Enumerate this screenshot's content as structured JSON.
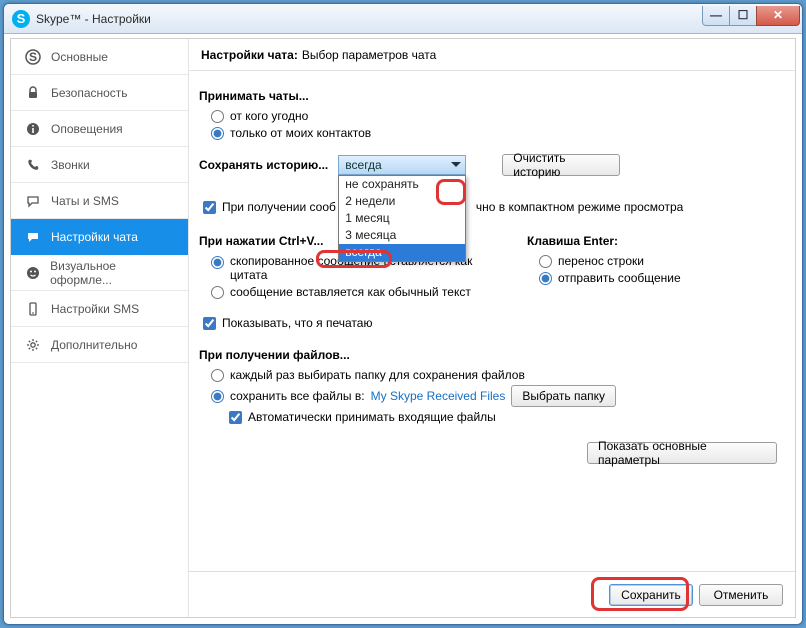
{
  "window": {
    "title": "Skype™ - Настройки"
  },
  "sidebar": {
    "items": [
      {
        "label": "Основные"
      },
      {
        "label": "Безопасность"
      },
      {
        "label": "Оповещения"
      },
      {
        "label": "Звонки"
      },
      {
        "label": "Чаты и SMS"
      },
      {
        "label": "Настройки чата"
      },
      {
        "label": "Визуальное оформле..."
      },
      {
        "label": "Настройки SMS"
      },
      {
        "label": "Дополнительно"
      }
    ]
  },
  "header": {
    "bold": "Настройки чата:",
    "rest": "Выбор параметров чата"
  },
  "accept": {
    "title": "Принимать чаты...",
    "opt1": "от кого угодно",
    "opt2": "только от моих контактов",
    "selected": "opt2"
  },
  "history": {
    "label": "Сохранять историю...",
    "selected": "всегда",
    "options": [
      "не сохранять",
      "2 недели",
      "1 месяц",
      "3 месяца",
      "всегда"
    ],
    "clear_btn": "Очистить историю"
  },
  "compact": {
    "prefix": "При получении сооб",
    "suffix": "чно в компактном режиме просмотра",
    "checked": true
  },
  "ctrlv": {
    "title": "При нажатии Ctrl+V...",
    "opt1": "скопированное сообщение вставляется как цитата",
    "opt2": "сообщение вставляется как обычный текст",
    "selected": "opt1"
  },
  "enter": {
    "title": "Клавиша Enter:",
    "opt1": "перенос строки",
    "opt2": "отправить сообщение",
    "selected": "opt2"
  },
  "typing": {
    "label": "Показывать, что я печатаю",
    "checked": true
  },
  "files": {
    "title": "При получении файлов...",
    "opt1": "каждый раз выбирать папку для сохранения файлов",
    "opt2": "сохранить все файлы в:",
    "folder_link": "My Skype Received Files",
    "browse_btn": "Выбрать папку",
    "auto": {
      "label": "Автоматически принимать входящие файлы",
      "checked": true
    },
    "selected": "opt2"
  },
  "advanced_btn": "Показать основные параметры",
  "footer": {
    "save": "Сохранить",
    "cancel": "Отменить"
  }
}
